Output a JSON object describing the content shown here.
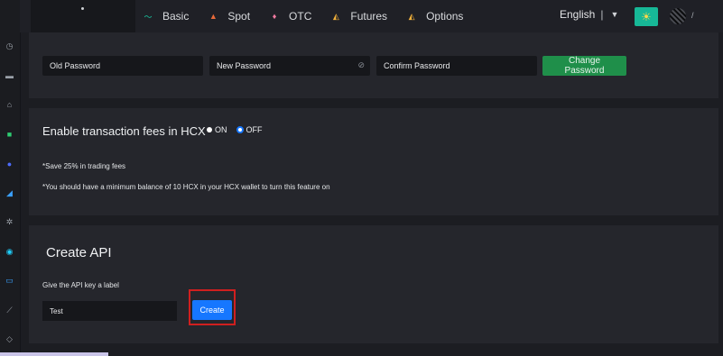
{
  "topbar": {
    "nav": [
      {
        "label": "Basic",
        "icon": "basic-icon"
      },
      {
        "label": "Spot",
        "icon": "spot-icon"
      },
      {
        "label": "OTC",
        "icon": "otc-icon"
      },
      {
        "label": "Futures",
        "icon": "futures-icon"
      },
      {
        "label": "Options",
        "icon": "options-icon"
      }
    ],
    "language": "English",
    "separator": "|",
    "caret": "▼"
  },
  "password": {
    "old_placeholder": "Old Password",
    "new_placeholder": "New Password",
    "confirm_placeholder": "Confirm Password",
    "change_button": "Change Password"
  },
  "fees": {
    "title": "Enable transaction fees in HCX",
    "on_label": "ON",
    "off_label": "OFF",
    "selected": "OFF",
    "note1": "*Save 25% in trading fees",
    "note2": "*You should have a minimum balance of 10 HCX in your HCX wallet to turn this feature on"
  },
  "api": {
    "title": "Create API",
    "label": "Give the API key a label",
    "input_value": "Test",
    "create_button": "Create"
  },
  "colors": {
    "accent_blue": "#1677ff",
    "accent_green": "#1f8f4a",
    "highlight_red": "#d01f1f",
    "theme_button": "#17b897"
  }
}
